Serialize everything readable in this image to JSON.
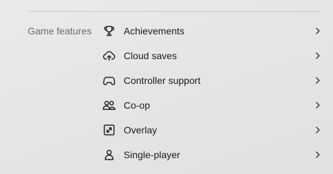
{
  "section": {
    "label": "Game features"
  },
  "features": [
    {
      "label": "Achievements",
      "icon": "trophy-icon"
    },
    {
      "label": "Cloud saves",
      "icon": "cloud-upload-icon"
    },
    {
      "label": "Controller support",
      "icon": "gamepad-icon"
    },
    {
      "label": "Co-op",
      "icon": "two-users-icon"
    },
    {
      "label": "Overlay",
      "icon": "expand-arrows-icon"
    },
    {
      "label": "Single-player",
      "icon": "single-user-icon"
    }
  ],
  "colors": {
    "background": "#e7e6e7",
    "text": "#1c1c1c",
    "muted": "#6b6b6e"
  }
}
